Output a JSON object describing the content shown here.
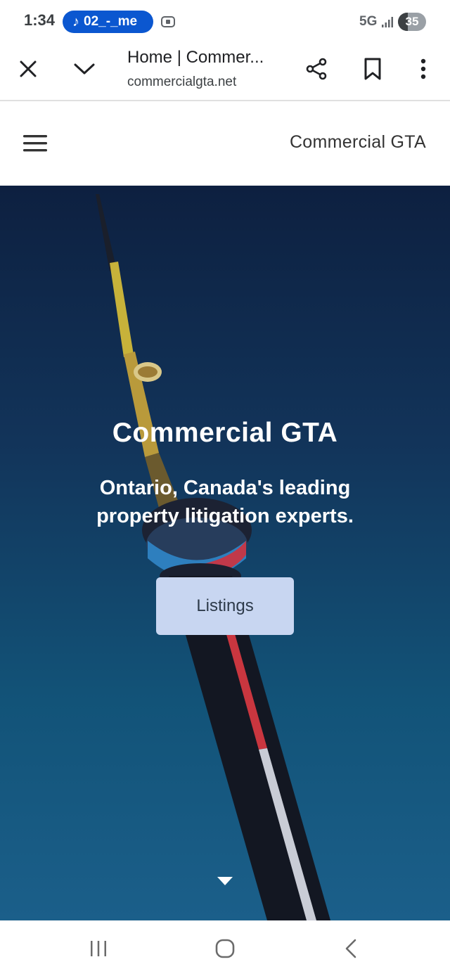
{
  "status_bar": {
    "time": "1:34",
    "media_pill": "02_-_me",
    "network": "5G",
    "battery": "35",
    "battery_level": 0.35,
    "media_pill_color": "#0b57d0"
  },
  "tab": {
    "title": "Home | Commer...",
    "url": "commercialgta.net",
    "icons": [
      "close-icon",
      "chevron-down-icon",
      "share-icon",
      "bookmark-icon",
      "more-vert-icon"
    ]
  },
  "site": {
    "brand": "Commercial GTA",
    "menu_icon": "menu-icon"
  },
  "hero": {
    "title": "Commercial GTA",
    "subtitle": "Ontario, Canada's leading property litigation experts.",
    "cta_label": "Listings",
    "cta_color": "#c8d6f1",
    "scroll_icon": "caret-down-icon"
  },
  "nav": {
    "icons": [
      "recent-apps-icon",
      "home-icon",
      "back-icon"
    ]
  }
}
